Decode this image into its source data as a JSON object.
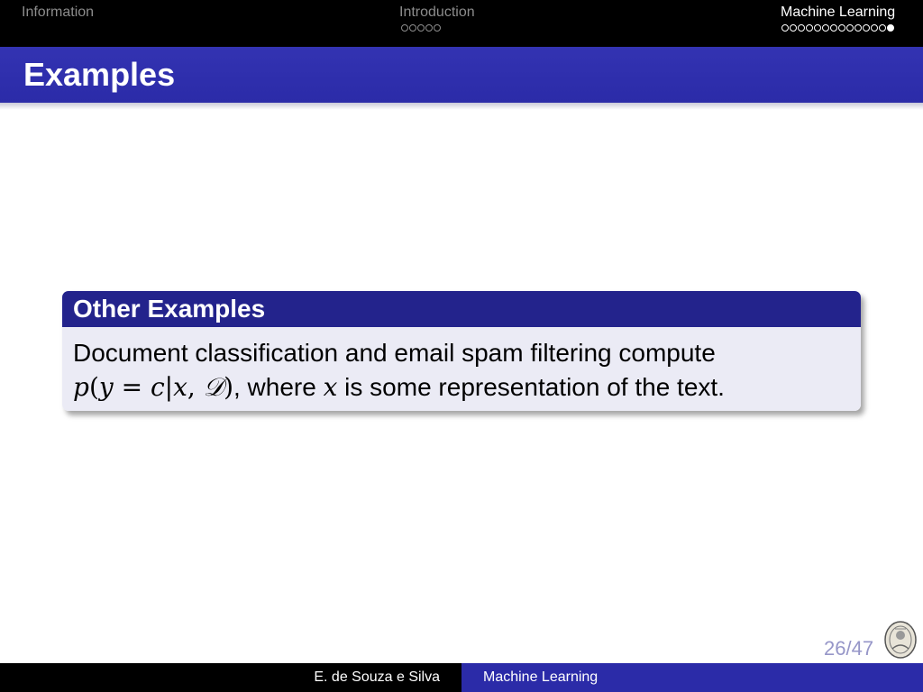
{
  "nav": {
    "sections": [
      {
        "label": "Information",
        "dot_count": 0,
        "active": false
      },
      {
        "label": "Introduction",
        "dot_count": 5,
        "active": false
      },
      {
        "label": "Machine Learning",
        "dot_count": 14,
        "active": true,
        "current_dot": 14
      }
    ]
  },
  "frame": {
    "title": "Examples"
  },
  "block": {
    "title": "Other Examples",
    "line1": "Document classification and email spam filtering compute",
    "formula_parts": {
      "p": "p",
      "open": "(",
      "y": "y",
      "eq": " = ",
      "c": "c",
      "bar": "|",
      "x": "x",
      "comma": ", ",
      "D": "𝒟",
      "close": ")"
    },
    "line2_rest": ", where ",
    "line2_var": "x",
    "line2_end": " is some representation of the text."
  },
  "page": {
    "number": "26/47"
  },
  "footer": {
    "author": "E. de Souza e Silva",
    "title": "Machine Learning"
  },
  "colors": {
    "title_bar": "#3333b2",
    "block_title": "#23238c",
    "block_body": "#ebebf5",
    "footer_right": "#2b2ba8"
  },
  "icons": {
    "logo": "university-seal-icon"
  }
}
